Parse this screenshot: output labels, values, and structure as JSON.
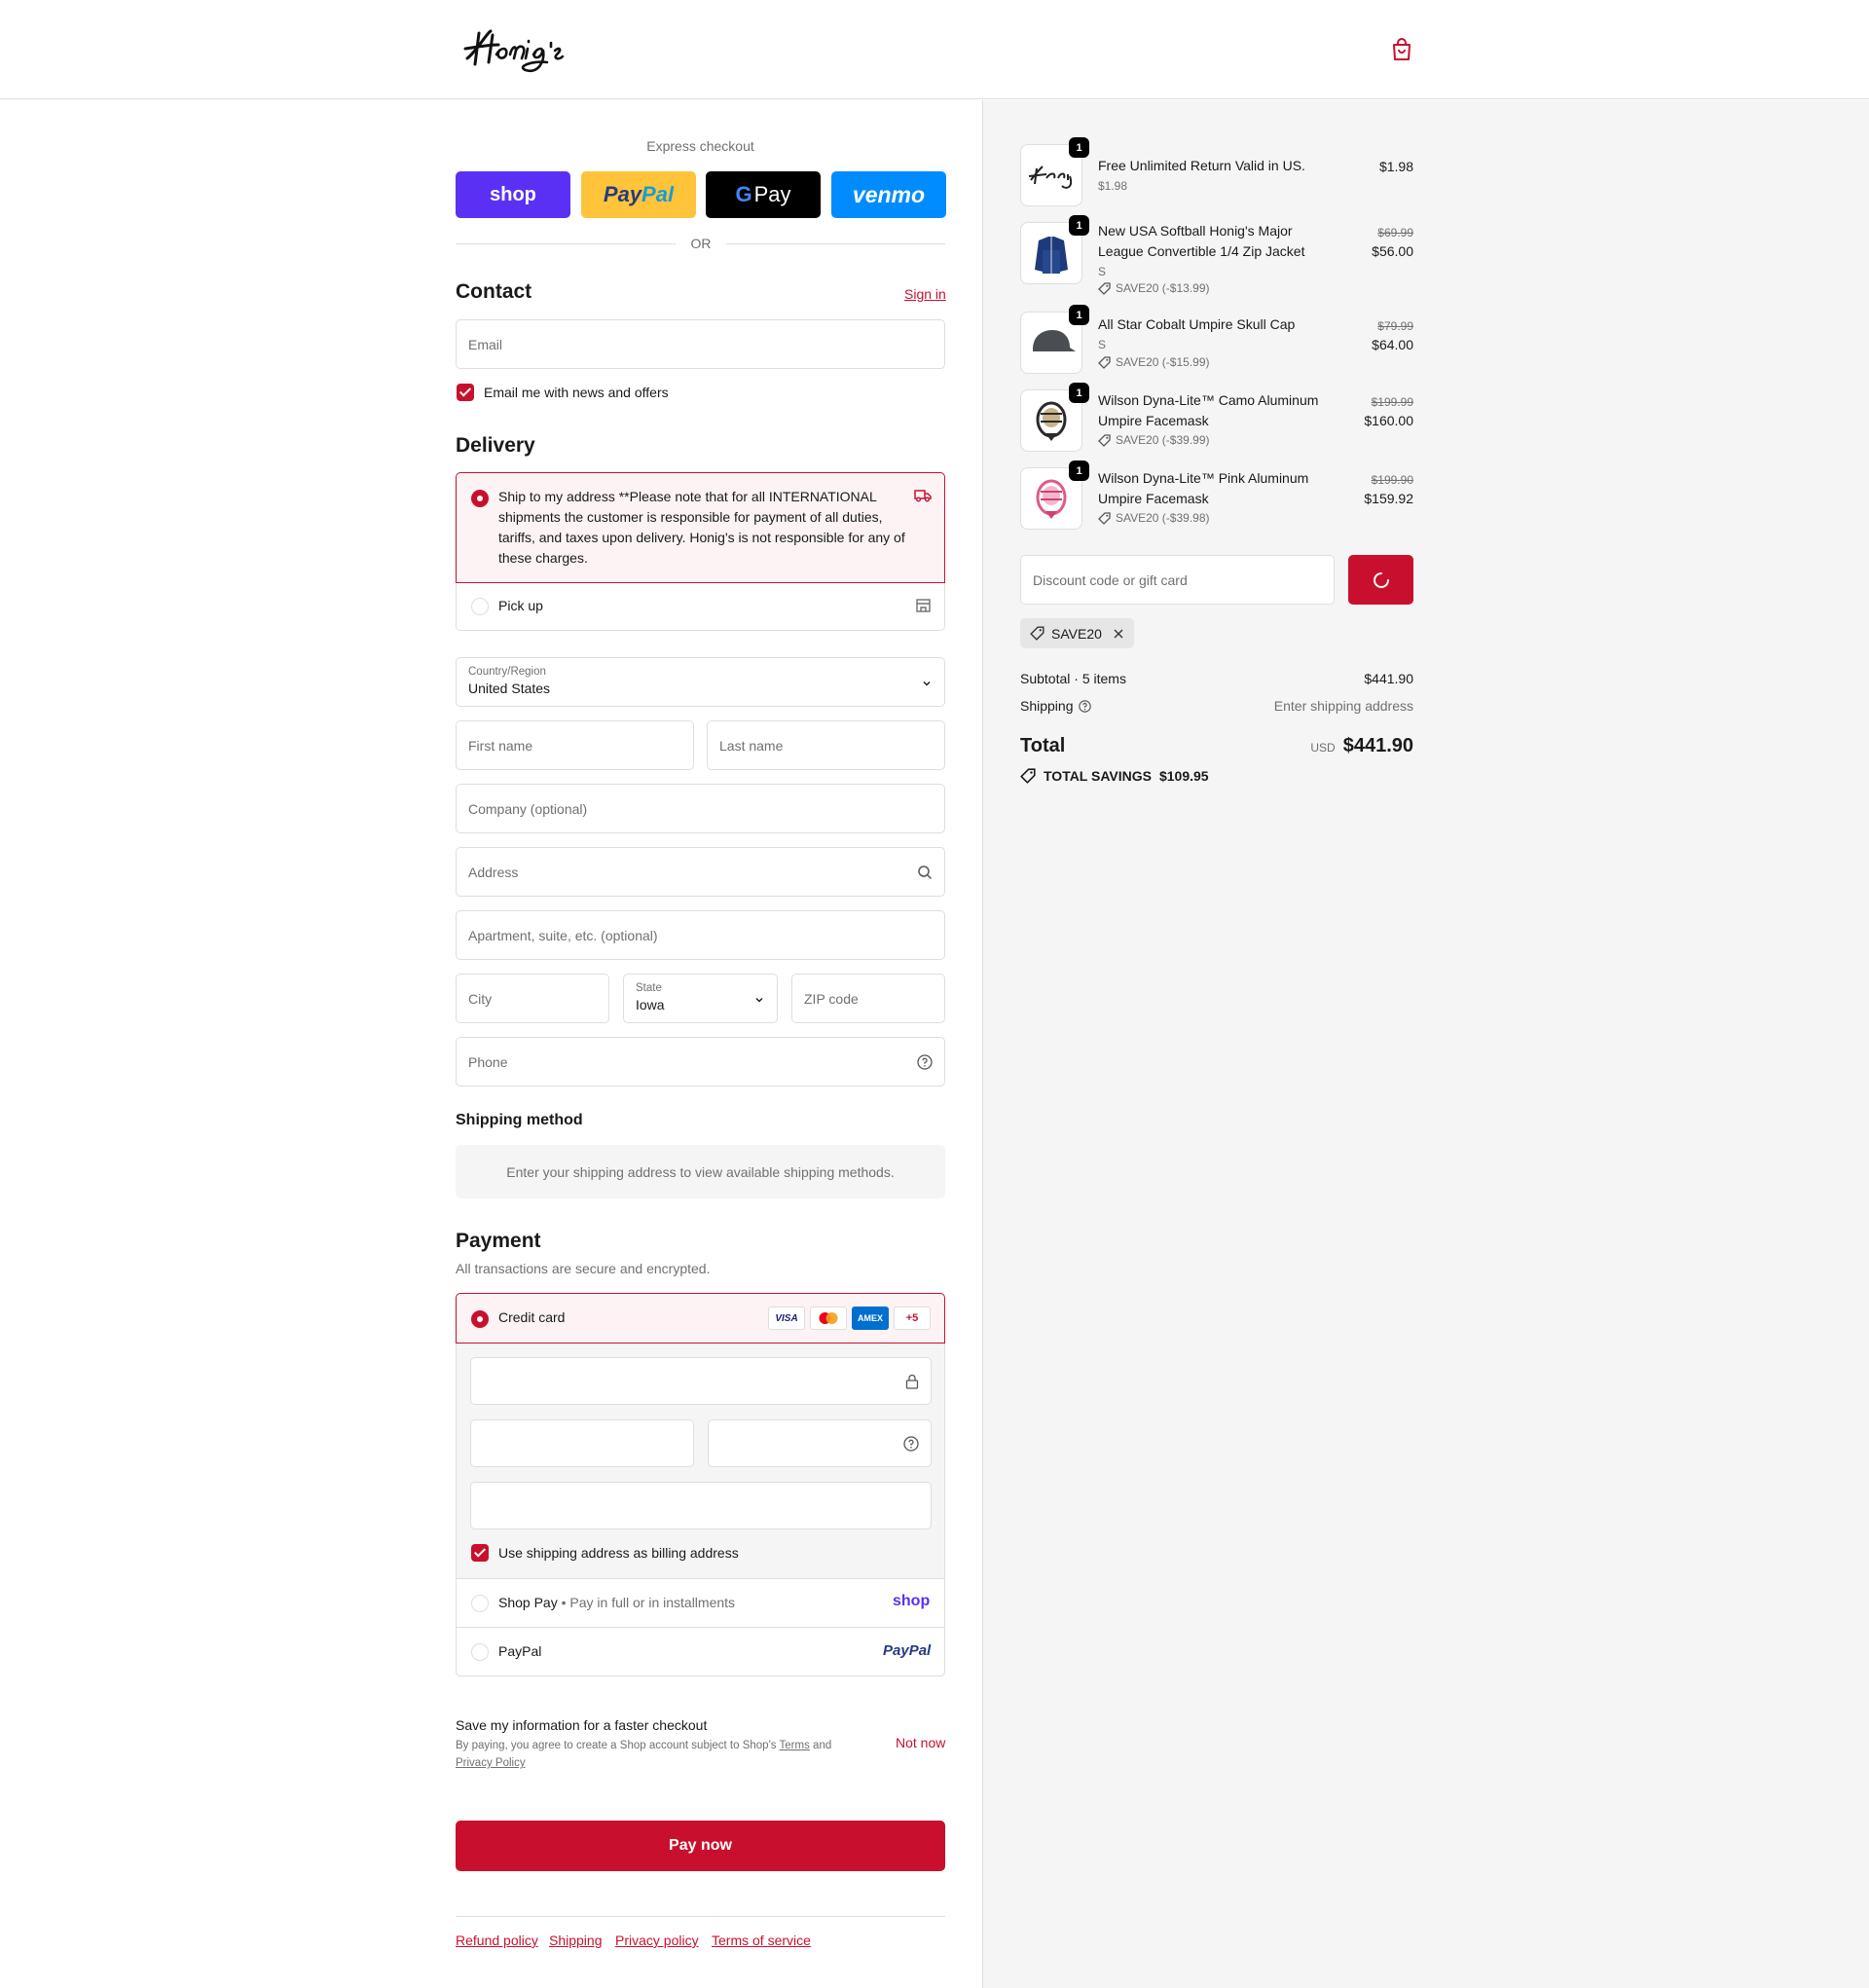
{
  "header": {
    "logo_text": "Honig's"
  },
  "express": {
    "label": "Express checkout",
    "buttons": [
      {
        "label": "shop",
        "color": "#5a31f4"
      },
      {
        "label": "PayPal",
        "color": "#ffc439"
      },
      {
        "label": "G Pay",
        "color": "#000000"
      },
      {
        "label": "venmo",
        "color": "#008cff"
      }
    ],
    "or": "OR"
  },
  "contact": {
    "title": "Contact",
    "sign_in": "Sign in",
    "email_placeholder": "Email",
    "news_label": "Email me with news and offers"
  },
  "delivery": {
    "title": "Delivery",
    "ship_label": "Ship to my address **Please note that for all INTERNATIONAL shipments the customer is responsible for payment of all duties, tariffs, and taxes upon delivery. Honig's is not responsible for any of these charges.",
    "pickup_label": "Pick up",
    "country_label": "Country/Region",
    "country_value": "United States",
    "first_name": "First name",
    "last_name": "Last name",
    "company": "Company (optional)",
    "address": "Address",
    "apartment": "Apartment, suite, etc. (optional)",
    "city": "City",
    "state_label": "State",
    "state_value": "Iowa",
    "zip": "ZIP code",
    "phone": "Phone"
  },
  "shipping_method": {
    "title": "Shipping method",
    "message": "Enter your shipping address to view available shipping methods."
  },
  "payment": {
    "title": "Payment",
    "subtitle": "All transactions are secure and encrypted.",
    "credit_card": "Credit card",
    "card_brands": [
      "VISA",
      "MC",
      "AMEX",
      "+5"
    ],
    "billing_label": "Use shipping address as billing address",
    "shop_pay": "Shop Pay",
    "shop_pay_sub": "Pay in full or in installments",
    "shop_pay_logo": "shop",
    "paypal": "PayPal",
    "paypal_logo": "PayPal"
  },
  "save_info": {
    "title": "Save my information for a faster checkout",
    "desc_prefix": "By paying, you agree to create a Shop account subject to Shop's",
    "terms": "Terms",
    "and": "and",
    "privacy": "Privacy Policy",
    "not_now": "Not now"
  },
  "pay_now": "Pay now",
  "footer": {
    "links": [
      "Refund policy",
      "Shipping",
      "Privacy policy",
      "Terms of service"
    ]
  },
  "summary": {
    "items": [
      {
        "name": "Free Unlimited Return Valid in US.",
        "sub": "$1.98",
        "discount": "",
        "old_price": "",
        "price": "$1.98",
        "qty": "1"
      },
      {
        "name": "New USA Softball Honig's Major League Convertible 1/4 Zip Jacket",
        "sub": "S",
        "discount": "SAVE20 (-$13.99)",
        "old_price": "$69.99",
        "price": "$56.00",
        "qty": "1"
      },
      {
        "name": "All Star Cobalt Umpire Skull Cap",
        "sub": "S",
        "discount": "SAVE20 (-$15.99)",
        "old_price": "$79.99",
        "price": "$64.00",
        "qty": "1"
      },
      {
        "name": "Wilson Dyna-Lite™ Camo Aluminum Umpire Facemask",
        "sub": "",
        "discount": "SAVE20 (-$39.99)",
        "old_price": "$199.99",
        "price": "$160.00",
        "qty": "1"
      },
      {
        "name": "Wilson Dyna-Lite™ Pink Aluminum Umpire Facemask",
        "sub": "",
        "discount": "SAVE20 (-$39.98)",
        "old_price": "$199.90",
        "price": "$159.92",
        "qty": "1"
      }
    ],
    "discount_placeholder": "Discount code or gift card",
    "applied_code": "SAVE20",
    "subtotal_label": "Subtotal · 5 items",
    "subtotal_value": "$441.90",
    "shipping_label": "Shipping",
    "shipping_value": "Enter shipping address",
    "total_label": "Total",
    "currency": "USD",
    "total_value": "$441.90",
    "savings_label": "TOTAL SAVINGS",
    "savings_value": "$109.95"
  }
}
